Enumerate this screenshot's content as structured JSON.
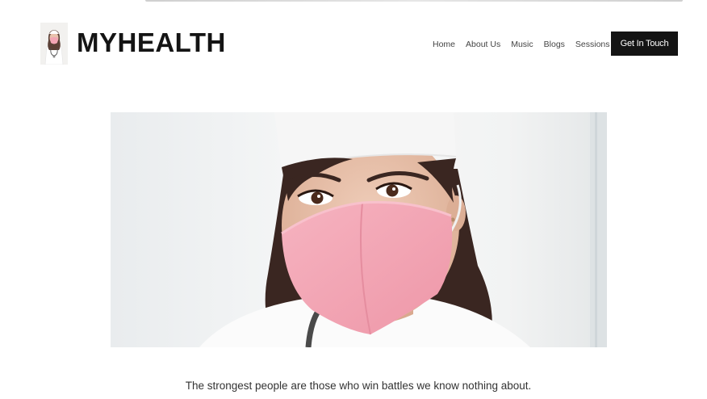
{
  "brand": {
    "name": "MYHEALTH"
  },
  "nav": {
    "items": [
      {
        "label": "Home"
      },
      {
        "label": "About Us"
      },
      {
        "label": "Music"
      },
      {
        "label": "Blogs"
      },
      {
        "label": "Sessions"
      }
    ],
    "cta_label": "Get In Touch"
  },
  "hero": {
    "mask_color": "#f3a5b4",
    "cap_color": "#f6f6f6"
  },
  "quote": {
    "text": "The strongest people are those who win battles we know nothing about."
  }
}
